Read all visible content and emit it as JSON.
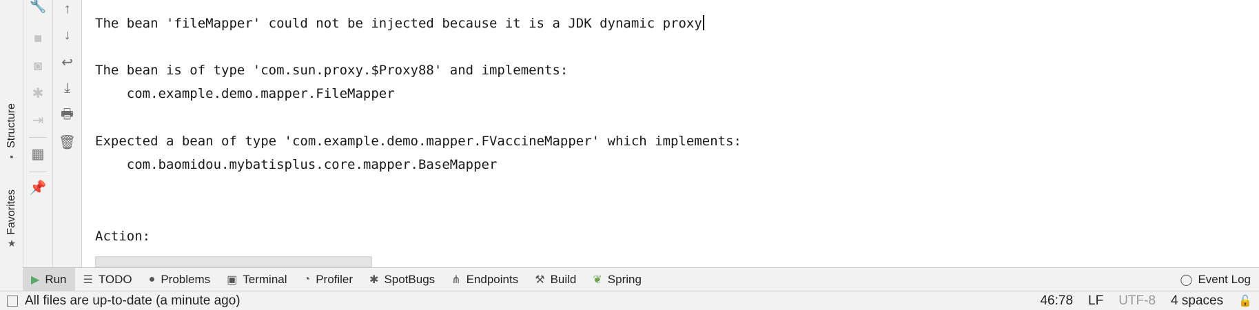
{
  "left_tabs": {
    "structure": {
      "label": "Structure",
      "icon": "structure-icon"
    },
    "favorites": {
      "label": "Favorites",
      "icon": "star-icon"
    }
  },
  "console": {
    "lines": [
      "The bean 'fileMapper' could not be injected because it is a JDK dynamic proxy",
      "The bean is of type 'com.sun.proxy.$Proxy88' and implements:",
      "    com.example.demo.mapper.FileMapper",
      "Expected a bean of type 'com.example.demo.mapper.FVaccineMapper' which implements:",
      "    com.baomidou.mybatisplus.core.mapper.BaseMapper",
      "Action:"
    ]
  },
  "toolwindows": [
    {
      "label": "Run",
      "icon": "run-icon",
      "active": true
    },
    {
      "label": "TODO",
      "icon": "todo-icon"
    },
    {
      "label": "Problems",
      "icon": "problems-icon"
    },
    {
      "label": "Terminal",
      "icon": "terminal-icon"
    },
    {
      "label": "Profiler",
      "icon": "profiler-icon"
    },
    {
      "label": "SpotBugs",
      "icon": "spotbugs-icon"
    },
    {
      "label": "Endpoints",
      "icon": "endpoints-icon"
    },
    {
      "label": "Build",
      "icon": "build-icon"
    },
    {
      "label": "Spring",
      "icon": "spring-icon"
    },
    {
      "label": "Event Log",
      "icon": "event-log-icon"
    }
  ],
  "status": {
    "message": "All files are up-to-date (a minute ago)",
    "position": "46:78",
    "line_separator": "LF",
    "encoding": "UTF-8",
    "indent": "4 spaces"
  },
  "colors": {
    "run_accent": "#59a869",
    "scroll_marker": "#c48a1f"
  }
}
